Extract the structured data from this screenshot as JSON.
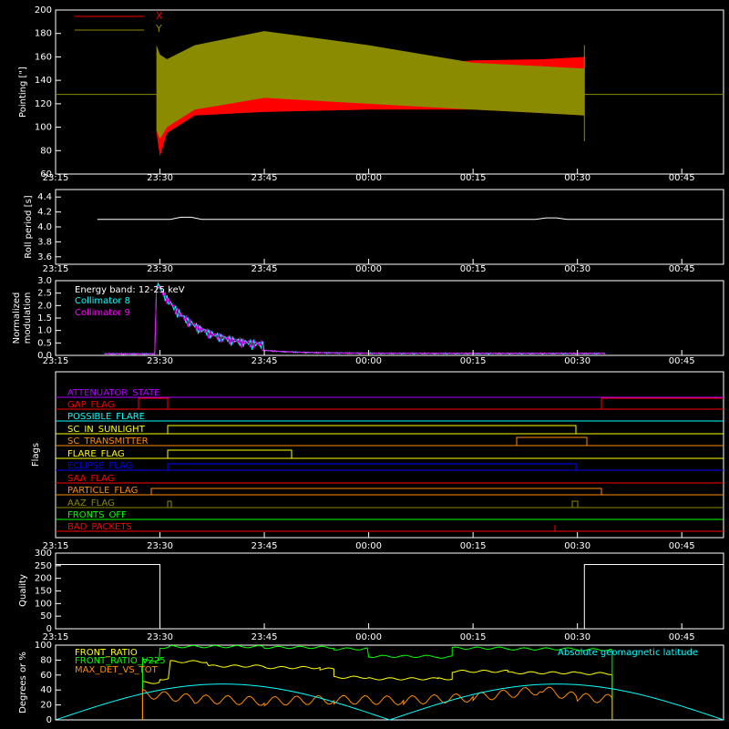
{
  "time_ticks": [
    "23:15",
    "23:30",
    "23:45",
    "00:00",
    "00:15",
    "00:30",
    "00:45"
  ],
  "colors": {
    "x": "#ff0000",
    "y": "#8b8b00",
    "cyan": "#00ffff",
    "magenta": "#ff00ff",
    "white": "#ffffff",
    "yellow": "#ffff00",
    "orange": "#ff8c00",
    "green": "#00ff00",
    "blue": "#0000ff",
    "red": "#ff0000",
    "purple": "#b000ff"
  },
  "chart_data": [
    {
      "type": "area",
      "ylabel": "Pointing [\"]",
      "ylim": [
        60,
        200
      ],
      "yticks": [
        "60",
        "80",
        "100",
        "120",
        "140",
        "160",
        "180",
        "200"
      ],
      "legend": [
        "X",
        "Y"
      ],
      "baseline_value": 128,
      "envelope_x": [
        "23:29:30",
        "23:30",
        "23:31",
        "23:35",
        "23:45",
        "00:00",
        "00:15",
        "00:25",
        "00:31"
      ],
      "series": [
        {
          "name": "X",
          "color": "red",
          "upper": [
            170,
            160,
            155,
            150,
            150,
            150,
            157,
            158,
            160
          ],
          "lower": [
            95,
            75,
            95,
            110,
            113,
            115,
            115,
            112,
            110
          ]
        },
        {
          "name": "Y",
          "color": "olive",
          "upper": [
            170,
            162,
            158,
            170,
            182,
            170,
            155,
            152,
            150
          ],
          "lower": [
            97,
            90,
            100,
            115,
            125,
            120,
            115,
            112,
            110
          ]
        }
      ]
    },
    {
      "type": "line",
      "ylabel": "Roll period [s]",
      "ylim": [
        3.5,
        4.5
      ],
      "yticks": [
        "3.6",
        "3.8",
        "4.0",
        "4.2",
        "4.4"
      ],
      "value": 4.1
    },
    {
      "type": "line",
      "ylabel": "Normalized modulation",
      "ylim": [
        0,
        3.0
      ],
      "yticks": [
        "0.0",
        "0.5",
        "1.0",
        "1.5",
        "2.0",
        "2.5",
        "3.0"
      ],
      "annotation": "Energy band: 12-25 keV",
      "series": [
        {
          "name": "Collimator 8",
          "color": "cyan"
        },
        {
          "name": "Collimator 9",
          "color": "magenta"
        }
      ]
    },
    {
      "type": "table",
      "ylabel": "Flags",
      "flags": [
        {
          "name": "ATTENUATOR_STATE",
          "color": "purple"
        },
        {
          "name": "GAP_FLAG",
          "color": "red"
        },
        {
          "name": "POSSIBLE_FLARE",
          "color": "cyan"
        },
        {
          "name": "SC_IN_SUNLIGHT",
          "color": "yellow"
        },
        {
          "name": "SC_TRANSMITTER",
          "color": "orange"
        },
        {
          "name": "FLARE_FLAG",
          "color": "yellow"
        },
        {
          "name": "ECLIPSE_FLAG",
          "color": "blue"
        },
        {
          "name": "SAA_FLAG",
          "color": "red"
        },
        {
          "name": "PARTICLE_FLAG",
          "color": "orange"
        },
        {
          "name": "AAZ_FLAG",
          "color": "olive"
        },
        {
          "name": "FRONTS_OFF",
          "color": "green"
        },
        {
          "name": "BAD_PACKETS",
          "color": "red"
        }
      ]
    },
    {
      "type": "line",
      "ylabel": "Quality",
      "ylim": [
        0,
        300
      ],
      "yticks": [
        "0",
        "50",
        "100",
        "150",
        "200",
        "250",
        "300"
      ],
      "x": [
        "23:15",
        "23:30",
        "23:30",
        "00:31",
        "00:31",
        "00:51"
      ],
      "values": [
        255,
        255,
        0,
        0,
        255,
        255
      ]
    },
    {
      "type": "line",
      "ylabel": "Degrees or %",
      "ylim": [
        0,
        100
      ],
      "yticks": [
        "0",
        "20",
        "40",
        "60",
        "80",
        "100"
      ],
      "legend_left": [
        "FRONT_RATIO",
        "FRONT_RATIO_V225",
        "MAX_DET_VS_TOT"
      ],
      "legend_right": "Absolute geomagnetic latitude",
      "series": [
        {
          "name": "FRONT_RATIO",
          "color": "yellow",
          "x": [
            "23:27:30",
            "23:30",
            "23:31:30",
            "23:37",
            "23:45",
            "23:53",
            "23:55",
            "00:00",
            "00:10",
            "00:12",
            "00:20",
            "00:30",
            "00:35"
          ],
          "values": [
            50,
            55,
            78,
            72,
            70,
            68,
            57,
            55,
            55,
            65,
            63,
            62,
            60
          ]
        },
        {
          "name": "FRONT_RATIO_V225",
          "color": "green",
          "x": [
            "23:27:30",
            "23:30",
            "23:31:30",
            "23:45",
            "23:55",
            "00:00",
            "00:10",
            "00:12",
            "00:20",
            "00:30",
            "00:35"
          ],
          "values": [
            80,
            97,
            98,
            97,
            95,
            85,
            84,
            96,
            95,
            94,
            93
          ]
        },
        {
          "name": "MAX_DET_VS_TOT",
          "color": "orange",
          "x": [
            "23:27:30",
            "23:35",
            "23:45",
            "23:55",
            "00:05",
            "00:15",
            "00:25",
            "00:30",
            "00:35"
          ],
          "values": [
            35,
            28,
            25,
            27,
            26,
            30,
            40,
            30,
            28
          ]
        },
        {
          "name": "Absolute geomagnetic latitude",
          "color": "cyan",
          "x": [
            "23:15",
            "23:30",
            "23:40",
            "23:50",
            "00:00",
            "00:15",
            "00:30",
            "00:40",
            "00:51"
          ],
          "values": [
            0,
            32,
            47,
            40,
            2,
            38,
            48,
            35,
            2
          ]
        }
      ]
    }
  ]
}
